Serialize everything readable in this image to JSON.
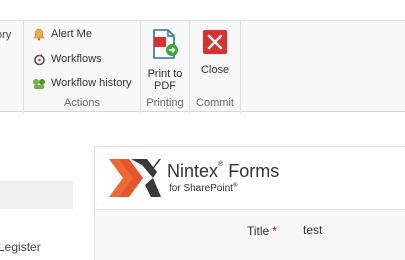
{
  "ribbon": {
    "left_partial_label": "ory",
    "actions": {
      "group_label": "Actions",
      "items": [
        {
          "label": "Alert Me",
          "icon": "bell-icon"
        },
        {
          "label": "Workflows",
          "icon": "workflow-icon"
        },
        {
          "label": "Workflow history",
          "icon": "workflow-history-icon"
        }
      ]
    },
    "printing": {
      "group_label": "Printing",
      "print_label_line1": "Print to",
      "print_label_line2": "PDF",
      "icon": "print-pdf-icon"
    },
    "commit": {
      "group_label": "Commit",
      "close_label": "Close",
      "icon": "close-icon"
    }
  },
  "left_panel": {
    "register_text": "Legister"
  },
  "form": {
    "brand_main": "Nintex",
    "brand_tm": "®",
    "brand_forms": " Forms",
    "brand_sub": "for SharePoint",
    "brand_sub_tm": "®",
    "field_label": "Title",
    "required_marker": "*",
    "field_value": "test"
  },
  "colors": {
    "accent_red": "#e02d2d",
    "logo_orange": "#e8542a",
    "logo_dark": "#3a3a3a",
    "pdf_blue": "#2f6db3",
    "pdf_green": "#3aaa35"
  }
}
